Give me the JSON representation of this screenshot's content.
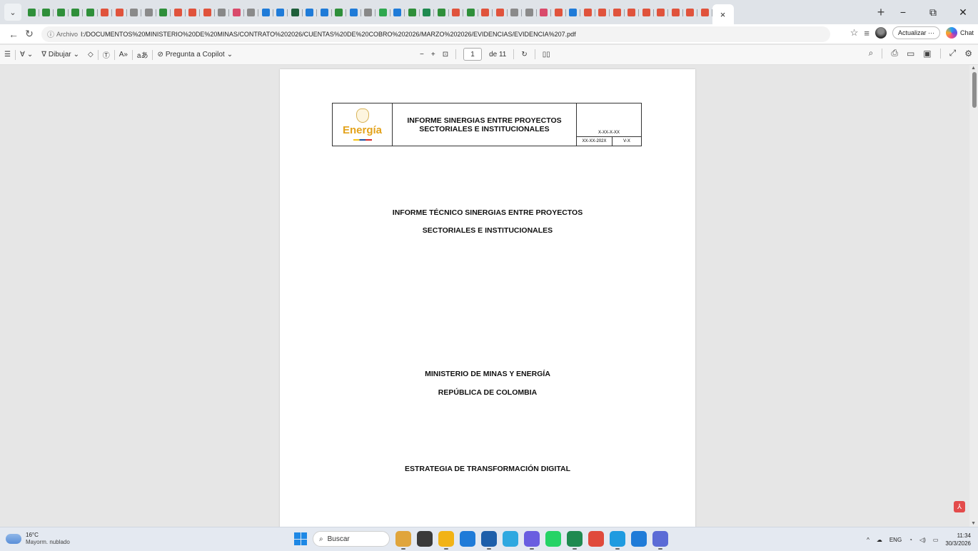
{
  "browser": {
    "tab_icon_colors": [
      "#2f8f3a",
      "#2f8f3a",
      "#2f8f3a",
      "#2f8f3a",
      "#2f8f3a",
      "#e0533c",
      "#e0533c",
      "#8a8a8a",
      "#8a8a8a",
      "#2f8f3a",
      "#e0533c",
      "#e0533c",
      "#e0533c",
      "#888888",
      "#d94a6b",
      "#8a8a8a",
      "#1f7bd8",
      "#1f7bd8",
      "#1f5f3a",
      "#1f7bd8",
      "#1f7bd8",
      "#2f8f3a",
      "#1f7bd8",
      "#888888",
      "#2fa84f",
      "#1f7bd8",
      "#2f8f3a",
      "#1f8a50",
      "#2f8f3a",
      "#e0533c",
      "#2f8f3a",
      "#e0533c",
      "#e0533c",
      "#8a8a8a",
      "#8a8a8a",
      "#d94a6b",
      "#e0533c",
      "#1f7bd8",
      "#e0533c",
      "#e0533c",
      "#e0533c",
      "#e0533c",
      "#e0533c",
      "#e0533c",
      "#e0533c",
      "#e0533c",
      "#e0533c"
    ],
    "active_tab_close": "×",
    "new_tab": "+",
    "window_controls": {
      "minimize": "−",
      "restore": "⧉",
      "close": "✕"
    },
    "address": {
      "scheme_label": "Archivo",
      "url": "I:/DOCUMENTOS%20MINISTERIO%20DE%20MINAS/CONTRATO%202026/CUENTAS%20DE%20COBRO%202026/MARZO%202026/EVIDENCIAS/EVIDENCIA%207.pdf",
      "update_button": "Actualizar ···",
      "chat_label": "Chat"
    }
  },
  "pdf_toolbar": {
    "draw_label": "Dibujar",
    "copilot_label": "Pregunta a Copilot",
    "current_page": "1",
    "page_total": "de 11",
    "minus": "−",
    "plus": "+"
  },
  "document": {
    "header_logo_text": "Energía",
    "header_title_line1": "INFORME SINERGIAS ENTRE PROYECTOS",
    "header_title_line2": "SECTORIALES E INSTITUCIONALES",
    "code_main": "X-XX-X-XX",
    "code_date": "XX-XX-202X",
    "code_version": "V-X",
    "title_line1": "INFORME TÉCNICO SINERGIAS ENTRE PROYECTOS",
    "title_line2": "SECTORIALES E INSTITUCIONALES",
    "ministry": "MINISTERIO DE MINAS Y ENERGÍA",
    "country": "REPÚBLICA DE COLOMBIA",
    "strategy": "ESTRATEGIA DE TRANSFORMACIÓN DIGITAL"
  },
  "taskbar": {
    "temperature": "16°C",
    "weather": "Mayorm. nublado",
    "search_placeholder": "Buscar",
    "language": "ENG",
    "time": "11:34",
    "date": "30/3/2026",
    "app_colors": [
      "#e0a53c",
      "#3a3a3a",
      "#f2b316",
      "#1f7bd8",
      "#1e5faa",
      "#2fa8e0",
      "#6a5ee0",
      "#25d366",
      "#1f8a50",
      "#e04a3c",
      "#1f9be0",
      "#1f7bd8",
      "#5b6bd6"
    ]
  }
}
